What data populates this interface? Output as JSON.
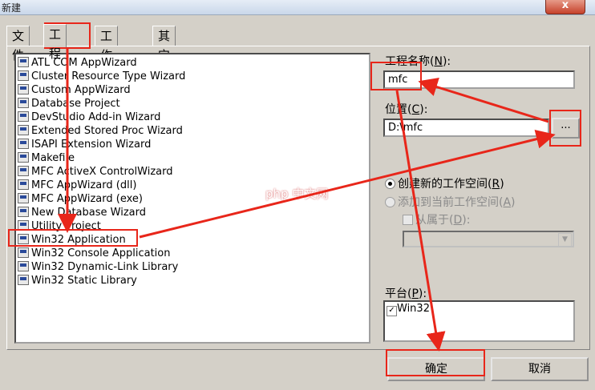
{
  "window": {
    "title": "新建",
    "close_glyph": "x"
  },
  "tabs": [
    {
      "label": "文件"
    },
    {
      "label": "工程",
      "active": true
    },
    {
      "label": "工作区"
    },
    {
      "label": "其它文档"
    }
  ],
  "project_types": [
    "ATL COM AppWizard",
    "Cluster Resource Type Wizard",
    "Custom AppWizard",
    "Database Project",
    "DevStudio Add-in Wizard",
    "Extended Stored Proc Wizard",
    "ISAPI Extension Wizard",
    "Makefile",
    "MFC ActiveX ControlWizard",
    "MFC AppWizard (dll)",
    "MFC AppWizard (exe)",
    "New Database Wizard",
    "Utility Project",
    "Win32 Application",
    "Win32 Console Application",
    "Win32 Dynamic-Link Library",
    "Win32 Static Library"
  ],
  "selected_project_type": "Win32 Application",
  "project_name": {
    "label_pre": "工程名称(",
    "accel": "N",
    "label_post": "):",
    "value": "mfc"
  },
  "location": {
    "label_pre": "位置(",
    "accel": "C",
    "label_post": "):",
    "value": "D:\\mfc",
    "browse_label": "..."
  },
  "workspace": {
    "create_new": {
      "label_pre": "创建新的工作空间(",
      "accel": "R",
      "label_post": ")",
      "checked": true
    },
    "add_current": {
      "label_pre": "添加到当前工作空间(",
      "accel": "A",
      "label_post": ")",
      "checked": false
    },
    "dependency": {
      "label_pre": "从属于(",
      "accel": "D",
      "label_post": "):",
      "checked": false
    }
  },
  "platform": {
    "label_pre": "平台(",
    "accel": "P",
    "label_post": "):",
    "items": [
      {
        "label": "Win32",
        "checked": true
      }
    ]
  },
  "buttons": {
    "ok": "确定",
    "cancel": "取消"
  },
  "watermark": "php 中文网",
  "colors": {
    "annotation": "#e8261a",
    "dialog_bg": "#d4d0c8"
  }
}
